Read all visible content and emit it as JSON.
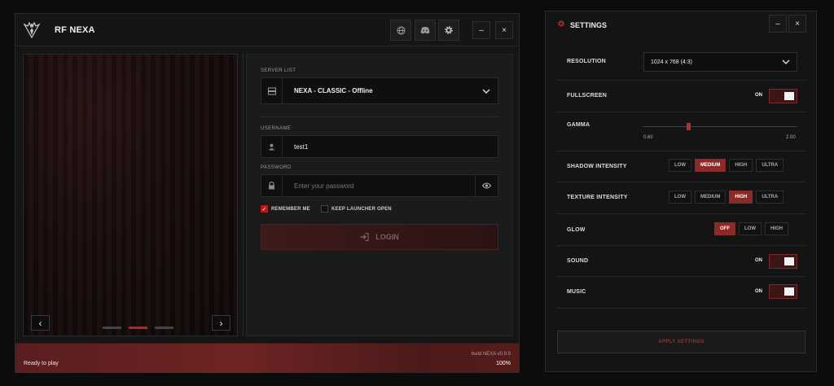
{
  "launcher": {
    "title": "RF NEXA",
    "toolbar": {
      "globe_icon": "globe-icon",
      "discord_icon": "discord-icon",
      "settings_icon": "gear-icon",
      "minimize": "–",
      "close": "×"
    },
    "form": {
      "server_list_label": "SERVER LIST",
      "server_value": "NEXA - CLASSIC - Offline",
      "username_label": "USERNAME",
      "username_value": "test1",
      "password_label": "PASSWORD",
      "password_placeholder": "Enter your password",
      "remember_me": "REMEMBER ME",
      "remember_checked": true,
      "keep_open": "KEEP LAUNCHER OPEN",
      "keep_open_checked": false,
      "login": "LOGIN"
    },
    "slider": {
      "prev": "‹",
      "next": "›",
      "slide_count": 3,
      "active_slide": 2
    },
    "status": {
      "text": "Ready to play",
      "build": "build NEXA v0.9.9",
      "percent": "100%",
      "progress": 1.0
    },
    "accent": "#b01c1c"
  },
  "settings": {
    "title": "SETTINGS",
    "minimize": "–",
    "close": "×",
    "resolution_label": "RESOLUTION",
    "resolution_value": "1024 x 768 (4:3)",
    "fullscreen_label": "FULLSCREEN",
    "fullscreen_state": "ON",
    "gamma_label": "GAMMA",
    "gamma_min": "0.60",
    "gamma_max": "2.00",
    "shadow_label": "SHADOW INTENSITY",
    "shadow_options": [
      "LOW",
      "MEDIUM",
      "HIGH",
      "ULTRA"
    ],
    "shadow_selected": "MEDIUM",
    "texture_label": "TEXTURE INTENSITY",
    "texture_options": [
      "LOW",
      "MEDIUM",
      "HIGH",
      "ULTRA"
    ],
    "texture_selected": "HIGH",
    "glow_label": "GLOW",
    "glow_options": [
      "OFF",
      "LOW",
      "HIGH"
    ],
    "glow_selected": "OFF",
    "sound_label": "SOUND",
    "sound_state": "ON",
    "music_label": "MUSIC",
    "music_state": "ON",
    "apply": "APPLY SETTINGS"
  }
}
